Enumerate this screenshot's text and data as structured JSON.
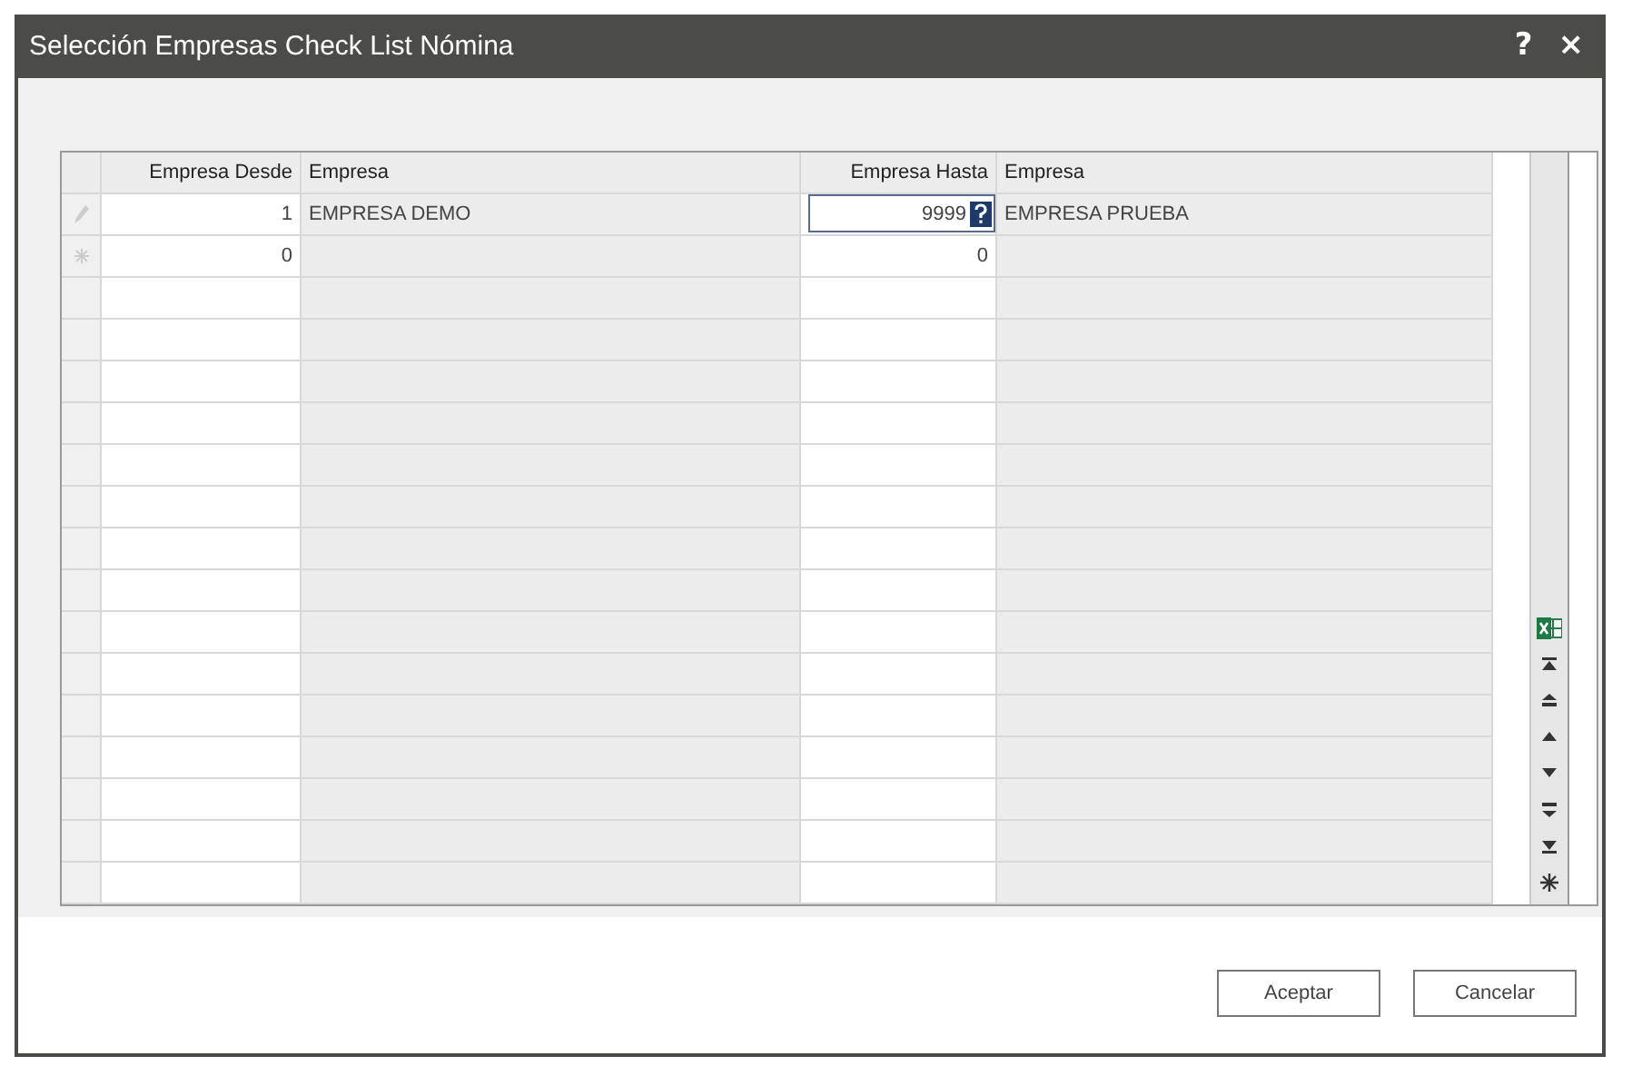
{
  "window": {
    "title": "Selección Empresas Check List Nómina",
    "help": "?",
    "close": "×"
  },
  "table": {
    "columns": [
      "Empresa Desde",
      "Empresa",
      "Empresa Hasta",
      "Empresa"
    ],
    "rows": [
      {
        "kind": "editing",
        "desde": "1",
        "empresa_desde": "EMPRESA DEMO",
        "hasta": "9999",
        "hasta_focused": true,
        "empresa_hasta": "EMPRESA PRUEBA"
      },
      {
        "kind": "new",
        "desde": "0",
        "hasta": "0",
        "hasta_focused": false
      }
    ]
  },
  "buttons": [
    "Aceptar",
    "Cancelar"
  ]
}
